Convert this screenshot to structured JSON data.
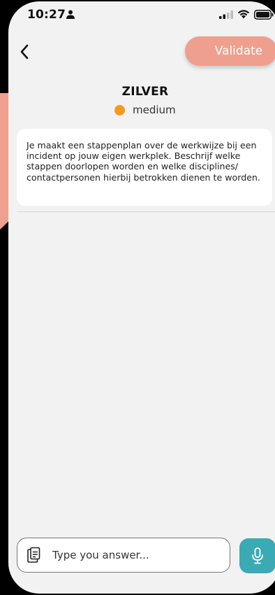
{
  "status_bar": {
    "time": "10:27",
    "person_icon": "person-icon",
    "signal_icon": "signal-bars-icon",
    "wifi_icon": "wifi-icon",
    "battery_icon": "battery-icon"
  },
  "header": {
    "back_icon": "chevron-left-icon",
    "validate_label": "Validate",
    "validate_color": "#ef9f8d"
  },
  "challenge": {
    "level": "ZILVER",
    "difficulty": "medium",
    "difficulty_color": "#f39a1f",
    "description": "Je maakt een stappenplan over de werkwijze bij een incident op jouw eigen werkplek. Beschrijf welke stappen doorlopen worden en welke disciplines/ contactpersonen hierbij betrokken dienen te worden."
  },
  "answer": {
    "placeholder": "Type you answer...",
    "value": "",
    "attach_icon": "clipboard-icon",
    "mic_icon": "microphone-icon",
    "mic_color": "#3aaab5"
  }
}
